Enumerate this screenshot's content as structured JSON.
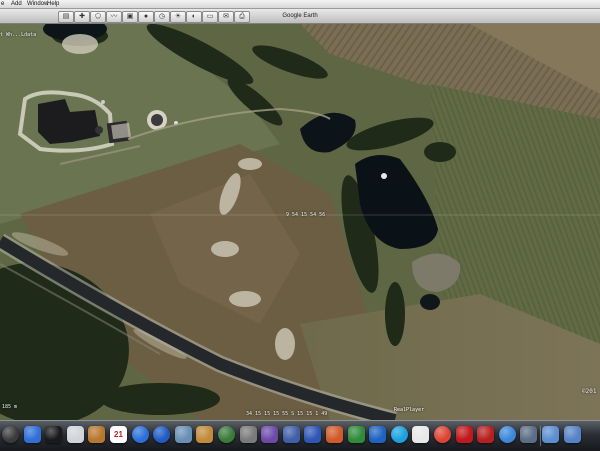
{
  "menubar": {
    "items": [
      "e",
      "Add",
      "Window",
      "Help"
    ]
  },
  "window": {
    "title": "Google Earth"
  },
  "map": {
    "corner_label": "t Wh...Ldata",
    "center_coordinate": "9 54 15 54 56",
    "bottom_coordinate": "34 15 15 15 55 S 15 15 1 49",
    "realplayer_label": "RealPlayer",
    "copyright": "©201",
    "scale_label": "185 m"
  },
  "dock": {
    "icons": [
      {
        "name": "disk-icon",
        "color": "#3b3b3b"
      },
      {
        "name": "finder-icon",
        "color": "#2f6fd6"
      },
      {
        "name": "dashboard-icon",
        "color": "#1a1a1a"
      },
      {
        "name": "mail-icon",
        "color": "#d0d4d8"
      },
      {
        "name": "address-book-icon",
        "color": "#b8772f"
      },
      {
        "name": "ical-icon",
        "color": "#ffffff",
        "text": "21"
      },
      {
        "name": "itunes-icon",
        "color": "#2b6fd9"
      },
      {
        "name": "itunes-2-icon",
        "color": "#1f5cc4"
      },
      {
        "name": "iphoto-icon",
        "color": "#6a8fb5"
      },
      {
        "name": "garageband-icon",
        "color": "#c28b3b"
      },
      {
        "name": "time-machine-icon",
        "color": "#3a7a3a"
      },
      {
        "name": "system-preferences-icon",
        "color": "#7a7a7a"
      },
      {
        "name": "screenshot-icon",
        "color": "#6d4aa8"
      },
      {
        "name": "ms-office-icon",
        "color": "#3f5fa8"
      },
      {
        "name": "word-icon",
        "color": "#2f55b6"
      },
      {
        "name": "powerpoint-icon",
        "color": "#d05a2a"
      },
      {
        "name": "excel-icon",
        "color": "#2f8a3a"
      },
      {
        "name": "entourage-icon",
        "color": "#1f62c0"
      },
      {
        "name": "skype-icon",
        "color": "#1aa1e0"
      },
      {
        "name": "text-edit-icon",
        "color": "#e8e8e8"
      },
      {
        "name": "chrome-icon",
        "color": "#dd4433"
      },
      {
        "name": "acrobat-icon",
        "color": "#c0181c"
      },
      {
        "name": "pdf-icon",
        "color": "#b82020"
      },
      {
        "name": "messages-icon",
        "color": "#3c87d8"
      },
      {
        "name": "spotlight-icon",
        "color": "#5b6e86"
      },
      {
        "name": "folder-icon",
        "color": "#5d8ed0"
      },
      {
        "name": "downloads-icon",
        "color": "#5683c4"
      }
    ]
  }
}
